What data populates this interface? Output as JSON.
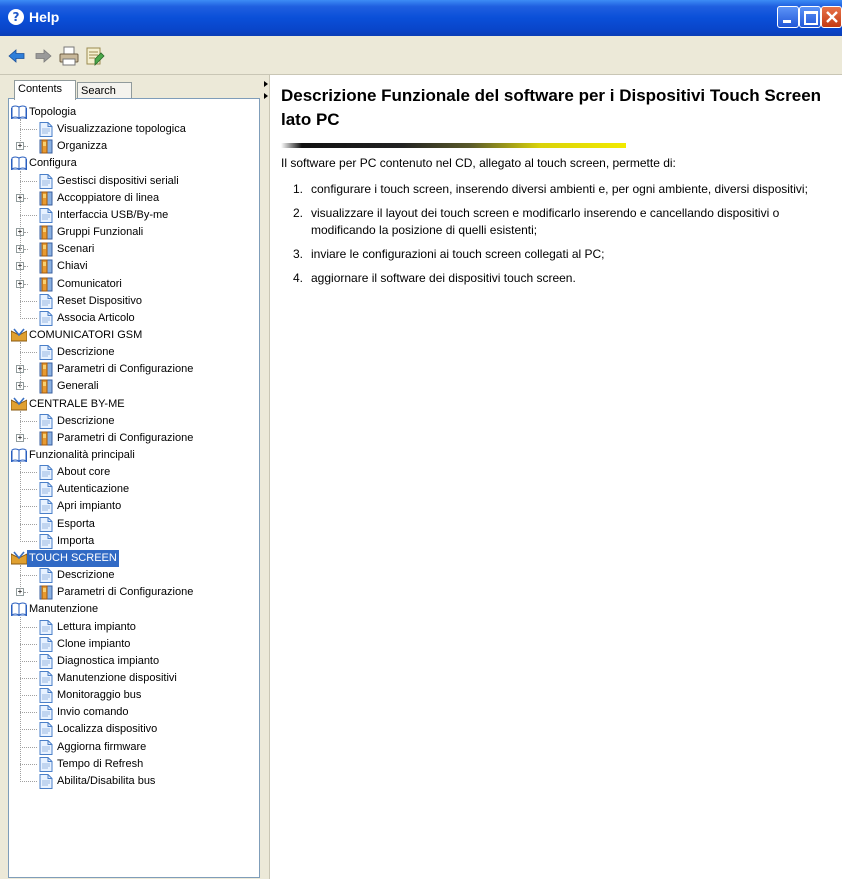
{
  "window": {
    "title": "Help"
  },
  "toolbar": {
    "buttons": [
      "back-icon",
      "forward-icon",
      "print-icon",
      "options-icon"
    ]
  },
  "tabs": {
    "contents": "Contents",
    "search": "Search"
  },
  "tree": [
    {
      "label": "Topologia",
      "type": "book",
      "level": 0
    },
    {
      "label": "Visualizzazione topologica",
      "type": "page",
      "level": 1
    },
    {
      "label": "Organizza",
      "type": "folder",
      "level": 1,
      "expander": "+"
    },
    {
      "label": "Configura",
      "type": "book",
      "level": 0
    },
    {
      "label": "Gestisci dispositivi seriali",
      "type": "page",
      "level": 1
    },
    {
      "label": "Accoppiatore di linea",
      "type": "folder",
      "level": 1,
      "expander": "+"
    },
    {
      "label": "Interfaccia USB/By-me",
      "type": "page",
      "level": 1
    },
    {
      "label": "Gruppi Funzionali",
      "type": "folder",
      "level": 1,
      "expander": "+"
    },
    {
      "label": "Scenari",
      "type": "folder",
      "level": 1,
      "expander": "+"
    },
    {
      "label": "Chiavi",
      "type": "folder",
      "level": 1,
      "expander": "+"
    },
    {
      "label": "Comunicatori",
      "type": "folder",
      "level": 1,
      "expander": "+"
    },
    {
      "label": "Reset Dispositivo",
      "type": "page",
      "level": 1
    },
    {
      "label": "Associa Articolo",
      "type": "page",
      "level": 1
    },
    {
      "label": "COMUNICATORI GSM",
      "type": "module",
      "level": 0
    },
    {
      "label": "Descrizione",
      "type": "page",
      "level": 1
    },
    {
      "label": "Parametri di Configurazione",
      "type": "folder",
      "level": 1,
      "expander": "+"
    },
    {
      "label": "Generali",
      "type": "folder",
      "level": 1,
      "expander": "+"
    },
    {
      "label": "CENTRALE BY-ME",
      "type": "module",
      "level": 0
    },
    {
      "label": "Descrizione",
      "type": "page",
      "level": 1
    },
    {
      "label": "Parametri di Configurazione",
      "type": "folder",
      "level": 1,
      "expander": "+"
    },
    {
      "label": "Funzionalità principali",
      "type": "book",
      "level": 0
    },
    {
      "label": "About core",
      "type": "page",
      "level": 1
    },
    {
      "label": "Autenticazione",
      "type": "page",
      "level": 1
    },
    {
      "label": "Apri impianto",
      "type": "page",
      "level": 1
    },
    {
      "label": "Esporta",
      "type": "page",
      "level": 1
    },
    {
      "label": "Importa",
      "type": "page",
      "level": 1
    },
    {
      "label": "TOUCH SCREEN",
      "type": "module",
      "level": 0,
      "selected": true
    },
    {
      "label": "Descrizione",
      "type": "page",
      "level": 1
    },
    {
      "label": "Parametri di Configurazione",
      "type": "folder",
      "level": 1,
      "expander": "+"
    },
    {
      "label": "Manutenzione",
      "type": "book",
      "level": 0
    },
    {
      "label": "Lettura impianto",
      "type": "page",
      "level": 1
    },
    {
      "label": "Clone impianto",
      "type": "page",
      "level": 1
    },
    {
      "label": "Diagnostica impianto",
      "type": "page",
      "level": 1
    },
    {
      "label": "Manutenzione dispositivi",
      "type": "page",
      "level": 1
    },
    {
      "label": "Monitoraggio bus",
      "type": "page",
      "level": 1
    },
    {
      "label": "Invio comando",
      "type": "page",
      "level": 1
    },
    {
      "label": "Localizza dispositivo",
      "type": "page",
      "level": 1
    },
    {
      "label": "Aggiorna firmware",
      "type": "page",
      "level": 1
    },
    {
      "label": "Tempo di Refresh",
      "type": "page",
      "level": 1
    },
    {
      "label": "Abilita/Disabilita bus",
      "type": "page",
      "level": 1
    }
  ],
  "content": {
    "heading": "Descrizione Funzionale del software per i Dispositivi Touch Screen lato PC",
    "intro": "Il software per PC contenuto nel CD, allegato al touch screen, permette di:",
    "items": [
      {
        "num": "1.",
        "text": "configurare i touch screen, inserendo diversi ambienti e, per ogni ambiente, diversi dispositivi;"
      },
      {
        "num": "2.",
        "text": "visualizzare il layout dei touch screen e modificarlo inserendo e cancellando dispositivi o modificando la posizione di quelli esistenti;"
      },
      {
        "num": "3.",
        "text": "inviare le configurazioni ai touch screen collegati al PC;"
      },
      {
        "num": "4.",
        "text": "aggiornare il software dei dispositivi touch screen."
      }
    ]
  }
}
